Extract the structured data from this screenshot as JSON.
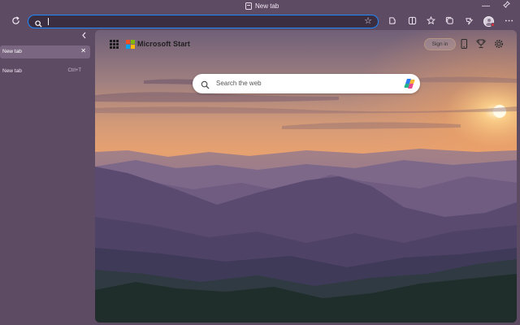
{
  "window": {
    "title": "New tab",
    "buttons": {
      "minimize": "—",
      "pin": "⊘"
    }
  },
  "toolbar": {
    "address_value": "",
    "icons": [
      "refresh-icon",
      "search-icon",
      "favorite-star-icon",
      "extensions-icon",
      "split-screen-icon",
      "favorites-icon",
      "collections-icon",
      "browser-essentials-icon",
      "profile-avatar",
      "more-options-icon"
    ]
  },
  "sidebar": {
    "tabs": [
      {
        "label": "New tab",
        "active": true,
        "close": "✕"
      }
    ],
    "new_tab": {
      "label": "New tab",
      "shortcut": "Ctrl+T"
    }
  },
  "newtab_page": {
    "brand": "Microsoft Start",
    "sign_in": "Sign in",
    "search_placeholder": "Search the web",
    "ms_logo_colors": [
      "#f25022",
      "#7fba00",
      "#00a4ef",
      "#ffb900"
    ]
  },
  "colors": {
    "chrome": "#5d4a63",
    "address_border": "#1e88ff",
    "active_tab": "#7a6680"
  }
}
